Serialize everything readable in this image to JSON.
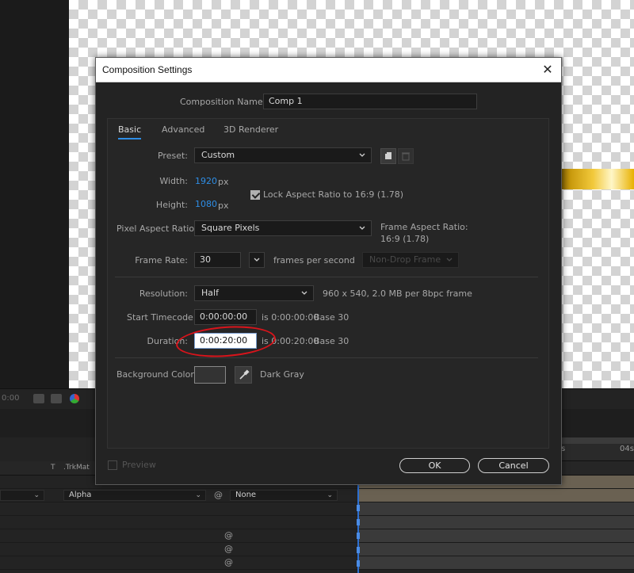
{
  "background": {
    "viewer_time": "0:00",
    "ruler": {
      "mark_s": "s",
      "mark_04s": "04s"
    },
    "timeline_columns": {
      "t": "T",
      "trkmat": ".TrkMat"
    },
    "layer_row": {
      "trkmat_value": "Alpha",
      "parent_value": "None"
    },
    "colors": {
      "gold_strip": "#f2c93b",
      "playhead": "#2d6fd0"
    }
  },
  "dialog": {
    "title": "Composition Settings",
    "close_icon": "close-icon",
    "comp_name": {
      "label": "Composition Name:",
      "value": "Comp 1"
    },
    "tabs": [
      {
        "label": "Basic",
        "active": true
      },
      {
        "label": "Advanced",
        "active": false
      },
      {
        "label": "3D Renderer",
        "active": false
      }
    ],
    "preset": {
      "label": "Preset:",
      "value": "Custom",
      "save_icon": "save-preset-icon",
      "delete_icon": "trash-icon"
    },
    "width": {
      "label": "Width:",
      "value": "1920",
      "unit": "px"
    },
    "height": {
      "label": "Height:",
      "value": "1080",
      "unit": "px"
    },
    "lock_aspect": {
      "label": "Lock Aspect Ratio to 16:9 (1.78)",
      "checked": true
    },
    "pixel_aspect": {
      "label": "Pixel Aspect Ratio:",
      "value": "Square Pixels"
    },
    "frame_aspect": {
      "label": "Frame Aspect Ratio:",
      "value": "16:9 (1.78)"
    },
    "frame_rate": {
      "label": "Frame Rate:",
      "value": "30",
      "suffix": "frames per second",
      "drop_frame": "Non-Drop Frame"
    },
    "resolution": {
      "label": "Resolution:",
      "value": "Half",
      "info": "960 x 540, 2.0 MB per 8bpc frame"
    },
    "start_timecode": {
      "label": "Start Timecode:",
      "value": "0:00:00:00",
      "is_text": "is 0:00:00:00",
      "base": "Base 30"
    },
    "duration": {
      "label": "Duration:",
      "value": "0:00:20:00",
      "is_text": "is 0:00:20:00",
      "base": "Base 30"
    },
    "background_color": {
      "label": "Background Color:",
      "value": "Dark Gray",
      "swatch_color": "#333333",
      "eyedropper_icon": "eyedropper-icon"
    },
    "preview": {
      "label": "Preview",
      "checked": false
    },
    "ok_label": "OK",
    "cancel_label": "Cancel",
    "annotation_color": "#d8141b"
  }
}
